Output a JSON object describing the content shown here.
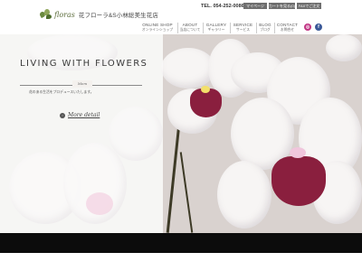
{
  "header": {
    "logo_script": "floras",
    "logo_text": "花フローラ&S小林総美生花店",
    "tel": "TEL. 054-252-0086",
    "top_buttons": [
      "マイページ",
      "カートを見る(0)",
      "FAXでご注文"
    ]
  },
  "nav": [
    {
      "en": "ONLINE SHOP",
      "ja": "オンラインショップ"
    },
    {
      "en": "ABOUT",
      "ja": "当店について"
    },
    {
      "en": "GALLERY",
      "ja": "ギャラリー"
    },
    {
      "en": "SERVICE",
      "ja": "サービス"
    },
    {
      "en": "BLOG",
      "ja": "ブログ"
    },
    {
      "en": "CONTACT",
      "ja": "お問合せ"
    }
  ],
  "social": {
    "instagram_icon": "instagram-icon",
    "facebook_icon": "facebook-icon",
    "instagram_color": "#c13584",
    "facebook_color": "#3b5998"
  },
  "hero": {
    "title": "LIVING WITH FLOWERS",
    "badge": "Mem",
    "subtitle": "花のある生活をプロデュースいたします。",
    "more_label": "More detail",
    "more_icon": "arrow-right-icon"
  },
  "colors": {
    "accent": "#6a8a3f",
    "button_gray": "#6f6f6f",
    "orchid_lip": "#8a1f3e"
  }
}
